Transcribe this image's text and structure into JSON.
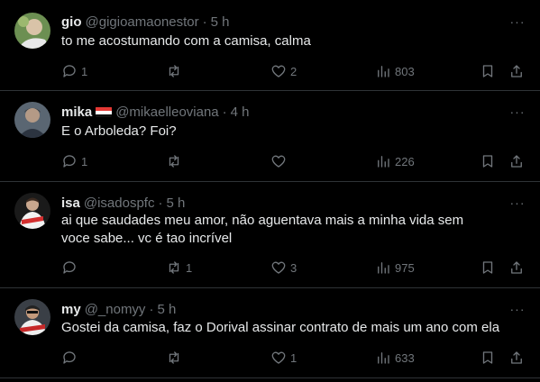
{
  "tweets": [
    {
      "name": "gio",
      "handle": "@gigioamaonestor",
      "dot": "·",
      "time": "5 h",
      "text": "to me acostumando com a camisa, calma",
      "replies": "1",
      "retweets": "",
      "likes": "2",
      "views": "803"
    },
    {
      "name": "mika",
      "handle": "@mikaelleoviana",
      "dot": "·",
      "time": "4 h",
      "text": "E o Arboleda? Foi?",
      "replies": "1",
      "retweets": "",
      "likes": "",
      "views": "226"
    },
    {
      "name": "isa",
      "handle": "@isadospfc",
      "dot": "·",
      "time": "5 h",
      "text": "ai que saudades meu amor, não aguentava mais a minha vida sem voce sabe... vc é tao incrível",
      "replies": "",
      "retweets": "1",
      "likes": "3",
      "views": "975"
    },
    {
      "name": "my",
      "handle": "@_nomyy",
      "dot": "·",
      "time": "5 h",
      "text": "Gostei da camisa, faz o Dorival assinar contrato de mais um ano com ela",
      "replies": "",
      "retweets": "",
      "likes": "1",
      "views": "633"
    }
  ],
  "more_label": "···",
  "icons": [
    "reply-icon",
    "retweet-icon",
    "like-icon",
    "views-icon",
    "bookmark-icon",
    "share-icon",
    "more-icon"
  ],
  "colors": {
    "background": "#000000",
    "text": "#e7e9ea",
    "muted": "#71767b",
    "divider": "#2f3336"
  }
}
